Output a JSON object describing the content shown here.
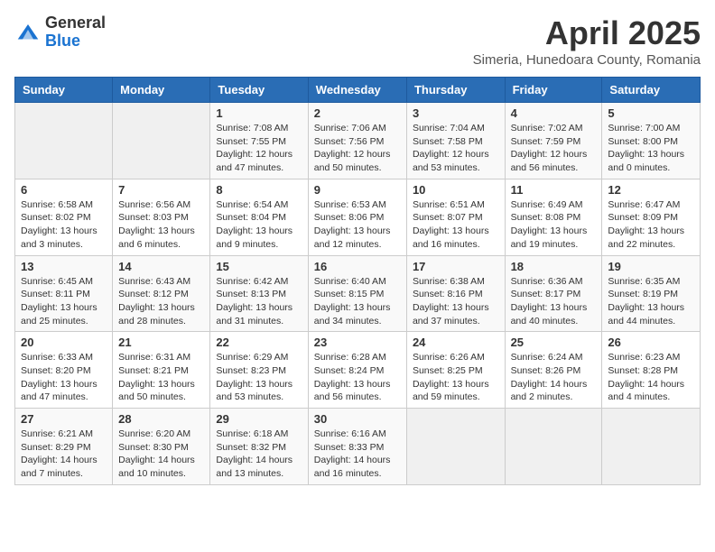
{
  "header": {
    "logo_general": "General",
    "logo_blue": "Blue",
    "title": "April 2025",
    "location": "Simeria, Hunedoara County, Romania"
  },
  "weekdays": [
    "Sunday",
    "Monday",
    "Tuesday",
    "Wednesday",
    "Thursday",
    "Friday",
    "Saturday"
  ],
  "weeks": [
    [
      {
        "day": "",
        "info": ""
      },
      {
        "day": "",
        "info": ""
      },
      {
        "day": "1",
        "info": "Sunrise: 7:08 AM\nSunset: 7:55 PM\nDaylight: 12 hours and 47 minutes."
      },
      {
        "day": "2",
        "info": "Sunrise: 7:06 AM\nSunset: 7:56 PM\nDaylight: 12 hours and 50 minutes."
      },
      {
        "day": "3",
        "info": "Sunrise: 7:04 AM\nSunset: 7:58 PM\nDaylight: 12 hours and 53 minutes."
      },
      {
        "day": "4",
        "info": "Sunrise: 7:02 AM\nSunset: 7:59 PM\nDaylight: 12 hours and 56 minutes."
      },
      {
        "day": "5",
        "info": "Sunrise: 7:00 AM\nSunset: 8:00 PM\nDaylight: 13 hours and 0 minutes."
      }
    ],
    [
      {
        "day": "6",
        "info": "Sunrise: 6:58 AM\nSunset: 8:02 PM\nDaylight: 13 hours and 3 minutes."
      },
      {
        "day": "7",
        "info": "Sunrise: 6:56 AM\nSunset: 8:03 PM\nDaylight: 13 hours and 6 minutes."
      },
      {
        "day": "8",
        "info": "Sunrise: 6:54 AM\nSunset: 8:04 PM\nDaylight: 13 hours and 9 minutes."
      },
      {
        "day": "9",
        "info": "Sunrise: 6:53 AM\nSunset: 8:06 PM\nDaylight: 13 hours and 12 minutes."
      },
      {
        "day": "10",
        "info": "Sunrise: 6:51 AM\nSunset: 8:07 PM\nDaylight: 13 hours and 16 minutes."
      },
      {
        "day": "11",
        "info": "Sunrise: 6:49 AM\nSunset: 8:08 PM\nDaylight: 13 hours and 19 minutes."
      },
      {
        "day": "12",
        "info": "Sunrise: 6:47 AM\nSunset: 8:09 PM\nDaylight: 13 hours and 22 minutes."
      }
    ],
    [
      {
        "day": "13",
        "info": "Sunrise: 6:45 AM\nSunset: 8:11 PM\nDaylight: 13 hours and 25 minutes."
      },
      {
        "day": "14",
        "info": "Sunrise: 6:43 AM\nSunset: 8:12 PM\nDaylight: 13 hours and 28 minutes."
      },
      {
        "day": "15",
        "info": "Sunrise: 6:42 AM\nSunset: 8:13 PM\nDaylight: 13 hours and 31 minutes."
      },
      {
        "day": "16",
        "info": "Sunrise: 6:40 AM\nSunset: 8:15 PM\nDaylight: 13 hours and 34 minutes."
      },
      {
        "day": "17",
        "info": "Sunrise: 6:38 AM\nSunset: 8:16 PM\nDaylight: 13 hours and 37 minutes."
      },
      {
        "day": "18",
        "info": "Sunrise: 6:36 AM\nSunset: 8:17 PM\nDaylight: 13 hours and 40 minutes."
      },
      {
        "day": "19",
        "info": "Sunrise: 6:35 AM\nSunset: 8:19 PM\nDaylight: 13 hours and 44 minutes."
      }
    ],
    [
      {
        "day": "20",
        "info": "Sunrise: 6:33 AM\nSunset: 8:20 PM\nDaylight: 13 hours and 47 minutes."
      },
      {
        "day": "21",
        "info": "Sunrise: 6:31 AM\nSunset: 8:21 PM\nDaylight: 13 hours and 50 minutes."
      },
      {
        "day": "22",
        "info": "Sunrise: 6:29 AM\nSunset: 8:23 PM\nDaylight: 13 hours and 53 minutes."
      },
      {
        "day": "23",
        "info": "Sunrise: 6:28 AM\nSunset: 8:24 PM\nDaylight: 13 hours and 56 minutes."
      },
      {
        "day": "24",
        "info": "Sunrise: 6:26 AM\nSunset: 8:25 PM\nDaylight: 13 hours and 59 minutes."
      },
      {
        "day": "25",
        "info": "Sunrise: 6:24 AM\nSunset: 8:26 PM\nDaylight: 14 hours and 2 minutes."
      },
      {
        "day": "26",
        "info": "Sunrise: 6:23 AM\nSunset: 8:28 PM\nDaylight: 14 hours and 4 minutes."
      }
    ],
    [
      {
        "day": "27",
        "info": "Sunrise: 6:21 AM\nSunset: 8:29 PM\nDaylight: 14 hours and 7 minutes."
      },
      {
        "day": "28",
        "info": "Sunrise: 6:20 AM\nSunset: 8:30 PM\nDaylight: 14 hours and 10 minutes."
      },
      {
        "day": "29",
        "info": "Sunrise: 6:18 AM\nSunset: 8:32 PM\nDaylight: 14 hours and 13 minutes."
      },
      {
        "day": "30",
        "info": "Sunrise: 6:16 AM\nSunset: 8:33 PM\nDaylight: 14 hours and 16 minutes."
      },
      {
        "day": "",
        "info": ""
      },
      {
        "day": "",
        "info": ""
      },
      {
        "day": "",
        "info": ""
      }
    ]
  ]
}
